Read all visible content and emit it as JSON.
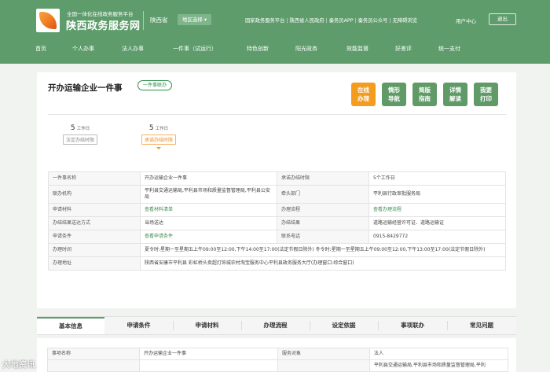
{
  "header": {
    "site_subtitle": "全国一体化在线政务服务平台",
    "site_title": "陕西政务服务网",
    "province": "陕西省",
    "region_button": "地区选择 ▾",
    "links": [
      "国家政务服务平台",
      "陕西省人民政府",
      "秦务员APP",
      "秦务员公众号",
      "无障碍浏览"
    ],
    "user_center": "用户中心",
    "logout": "退出"
  },
  "nav": [
    "首页",
    "个人办事",
    "法人办事",
    "一件事（试运行）",
    "特色创新",
    "阳光政务",
    "效能监督",
    "好差评",
    "统一支付"
  ],
  "main": {
    "title": "开办运输企业一件事",
    "tag": "一件事联办",
    "actions": [
      {
        "line1": "在线",
        "line2": "办理",
        "color": "orange"
      },
      {
        "line1": "情形",
        "line2": "导航",
        "color": "green"
      },
      {
        "line1": "简版",
        "line2": "指南",
        "color": "green"
      },
      {
        "line1": "详情",
        "line2": "解读",
        "color": "green"
      },
      {
        "line1": "我要",
        "line2": "打印",
        "color": "green"
      }
    ],
    "time_limits": [
      {
        "value": "5",
        "unit": "工作日",
        "label": "法定办结时限"
      },
      {
        "value": "5",
        "unit": "工作日",
        "label": "承诺办结时限"
      }
    ],
    "info_rows": [
      {
        "k1": "一件事名称",
        "v1": "开办运输企业一件事",
        "k2": "承诺办结时限",
        "v2": "5个工作日"
      },
      {
        "k1": "联办机构",
        "v1": "平利县交通运输局,平利县市场和质量监督管理局,平利县公安局",
        "k2": "牵头部门",
        "v2": "平利县行政审批服务局"
      },
      {
        "k1": "申请材料",
        "v1": "查看材料清单",
        "k2": "办理流程",
        "v2": "查看办理流程"
      },
      {
        "k1": "办结结果送达方式",
        "v1": "当场送达",
        "k2": "办结结果",
        "v2": "道路运输经营许可证、道路运输证"
      },
      {
        "k1": "申请条件",
        "v1": "查看申请条件",
        "k2": "联系电话",
        "v2": "0915-8429772"
      }
    ],
    "hours_label": "办理时间",
    "hours_value": "夏令时:星期一至星期五上午09:00至12:00,下午14:00至17:00(法定节假日除外) 冬令时:星期一至星期五上午09:00至12:00,下午13:00至17:00(法定节假日除外)",
    "address_label": "办理地址",
    "address_value": "陕西省安康市平利县 彩虹桥头卖超灯饰城农村淘宝服务中心平利县政务服务大厅(办理窗口:综合窗口)"
  },
  "tabs": [
    "基本信息",
    "申请条件",
    "申请材料",
    "办理流程",
    "设定依据",
    "事项联办",
    "常见问题"
  ],
  "basic": {
    "rows": [
      {
        "k1": "事项名称",
        "v1": "开办运输企业一件事",
        "k2": "服务对象",
        "v2": "法人"
      },
      {
        "k1": "",
        "v1": "",
        "k2": "",
        "v2": "平利县交通运输局,平利县市场和质量监督管理局,平利"
      }
    ]
  },
  "watermark": "大地资讯"
}
